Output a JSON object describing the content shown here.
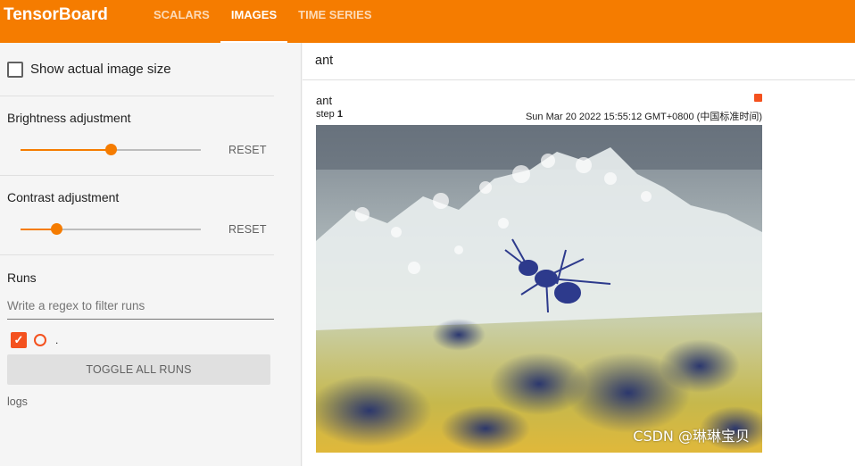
{
  "app": {
    "title": "TensorBoard"
  },
  "tabs": [
    {
      "label": "SCALARS",
      "active": false
    },
    {
      "label": "IMAGES",
      "active": true
    },
    {
      "label": "TIME SERIES",
      "active": false
    }
  ],
  "sidebar": {
    "show_actual_size": {
      "label": "Show actual image size",
      "checked": false
    },
    "brightness": {
      "label": "Brightness adjustment",
      "value": 0.5,
      "reset_label": "RESET"
    },
    "contrast": {
      "label": "Contrast adjustment",
      "value": 0.2,
      "reset_label": "RESET"
    },
    "runs": {
      "title": "Runs",
      "filter_placeholder": "Write a regex to filter runs",
      "items": [
        {
          "name": ".",
          "checked": true,
          "color": "#f4511e"
        }
      ],
      "toggle_label": "TOGGLE ALL RUNS",
      "logdir": "logs"
    }
  },
  "main": {
    "tag_filter": "ant",
    "card": {
      "title": "ant",
      "step_label": "step",
      "step_value": "1",
      "timestamp": "Sun Mar 20 2022 15:55:12 GMT+0800 (中国标准时间)"
    }
  },
  "watermark": "CSDN @琳琳宝贝",
  "colors": {
    "accent": "#f57c00",
    "run": "#f4511e"
  }
}
